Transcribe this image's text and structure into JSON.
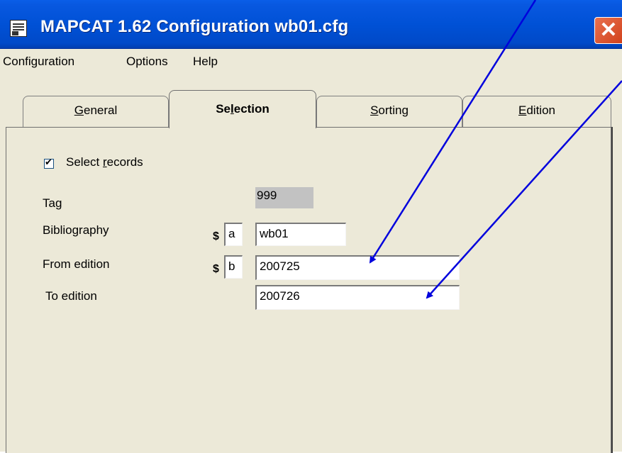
{
  "window": {
    "title": "MAPCAT 1.62 Configuration wb01.cfg",
    "close_label": "✕"
  },
  "menu": {
    "items": [
      "Configuration",
      "Options",
      "Help"
    ]
  },
  "tabs": [
    {
      "label": "General",
      "mnemonic": "G",
      "rest": "eneral"
    },
    {
      "label": "Selection",
      "pre": "Se",
      "mnemonic": "l",
      "rest": "ection",
      "active": true
    },
    {
      "label": "Sorting",
      "mnemonic": "S",
      "rest": "orting"
    },
    {
      "label": "Edition",
      "mnemonic": "E",
      "rest": "dition"
    }
  ],
  "selection": {
    "select_records": {
      "label_pre": "Select ",
      "mnemonic": "r",
      "label_rest": "ecords",
      "checked": true
    },
    "tag": {
      "label": "Tag",
      "value": "999"
    },
    "bibliography": {
      "label": "Bibliography",
      "dollar": "$",
      "subfield": "a",
      "value": "wb01"
    },
    "from_edition": {
      "label": "From edition",
      "dollar": "$",
      "subfield": "b",
      "value": "200725"
    },
    "to_edition": {
      "label": "To edition",
      "value": "200726"
    }
  },
  "colors": {
    "titlebar": "#0054e3",
    "dialog_bg": "#ece9d8",
    "arrow": "#0000dd",
    "tag_bg": "#c2c2c2"
  }
}
